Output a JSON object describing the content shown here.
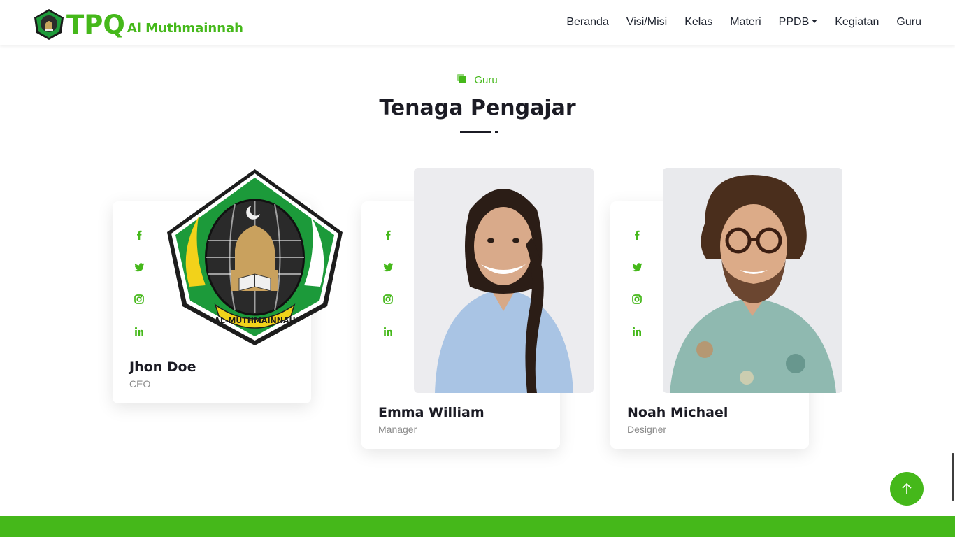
{
  "brand": {
    "tpq": "TPQ",
    "sub": "Al Muthmainnah",
    "logo_text": "AL-MUTHMAINNAH"
  },
  "nav": {
    "items": [
      {
        "label": "Beranda"
      },
      {
        "label": "Visi/Misi"
      },
      {
        "label": "Kelas"
      },
      {
        "label": "Materi"
      },
      {
        "label": "PPDB",
        "dropdown": true
      },
      {
        "label": "Kegiatan"
      },
      {
        "label": "Guru"
      }
    ]
  },
  "section": {
    "eyebrow": "Guru",
    "title": "Tenaga Pengajar"
  },
  "team": [
    {
      "name": "Jhon Doe",
      "role": "CEO",
      "photo": "school-logo"
    },
    {
      "name": "Emma William",
      "role": "Manager",
      "photo": "woman-portrait"
    },
    {
      "name": "Noah Michael",
      "role": "Designer",
      "photo": "man-portrait"
    }
  ],
  "social_icons": [
    "facebook-icon",
    "twitter-icon",
    "instagram-icon",
    "linkedin-icon"
  ],
  "colors": {
    "accent": "#45b81a",
    "dark": "#1b1b24",
    "muted": "#8a8a8a"
  }
}
